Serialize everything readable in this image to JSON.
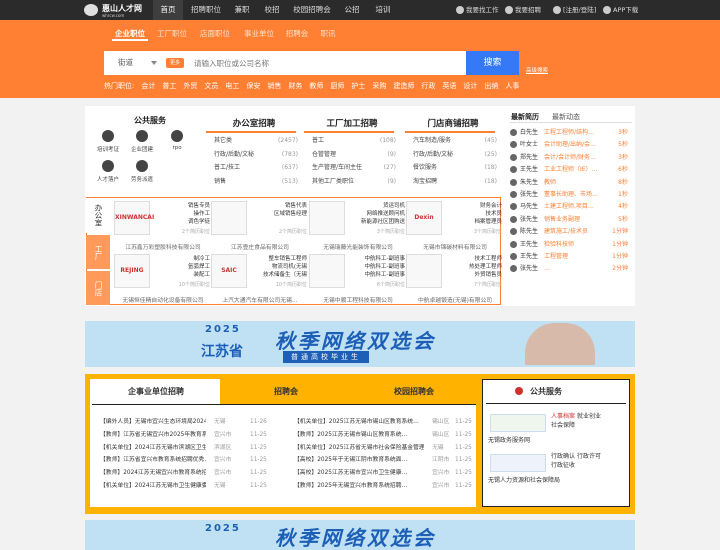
{
  "topbar": {
    "logo_name": "惠山人才网",
    "logo_sub": "whrcw.com",
    "nav": [
      "首页",
      "招聘职位",
      "兼职",
      "校招",
      "校园招聘会",
      "公招",
      "培训"
    ],
    "right": [
      "我要找工作",
      "我要招聘",
      "[注册/登陆]",
      "APP下载"
    ]
  },
  "search_tabs": [
    "企业职位",
    "工厂职位",
    "店面职位",
    "事业单位",
    "招聘会",
    "职讯"
  ],
  "search": {
    "city": "街道",
    "tag": "更多",
    "placeholder": "请输入职位或公司名称",
    "button": "搜索",
    "advanced": "高级搜索"
  },
  "hot": {
    "label": "热门职位:",
    "items": [
      "会计",
      "普工",
      "外贸",
      "文员",
      "电工",
      "保安",
      "销售",
      "财务",
      "教师",
      "厨师",
      "护士",
      "采购",
      "建造师",
      "行政",
      "英语",
      "设计",
      "出纳",
      "人事"
    ]
  },
  "public_services": {
    "title": "公共服务",
    "items": [
      "培训考证",
      "企业团建",
      "rpo",
      "人才落户",
      "劳务派遣"
    ]
  },
  "columns": [
    {
      "title": "办公室招聘",
      "rows": [
        {
          "n": "其它类",
          "c": "(2457)"
        },
        {
          "n": "行政/后勤/文秘",
          "c": "(783)"
        },
        {
          "n": "普工/技工",
          "c": "(637)"
        },
        {
          "n": "销售",
          "c": "(513)"
        }
      ]
    },
    {
      "title": "工厂加工招聘",
      "rows": [
        {
          "n": "普工",
          "c": "(108)"
        },
        {
          "n": "仓管管理",
          "c": "(9)"
        },
        {
          "n": "生产管理/车间主任",
          "c": "(27)"
        },
        {
          "n": "其他工厂类职位",
          "c": "(9)"
        }
      ]
    },
    {
      "title": "门店商铺招聘",
      "rows": [
        {
          "n": "汽车制造/服务",
          "c": "(45)"
        },
        {
          "n": "行政/后勤/文秘",
          "c": "(25)"
        },
        {
          "n": "餐饮服务",
          "c": "(18)"
        },
        {
          "n": "淘宝招聘",
          "c": "(18)"
        }
      ]
    }
  ],
  "news": {
    "tabs": [
      "最新简历",
      "最新动态"
    ],
    "rows": [
      {
        "n": "白先生",
        "p": "工程工程师/结构…",
        "t": "3秒"
      },
      {
        "n": "叶女士",
        "p": "会计助理/出纳/会…",
        "t": "5秒"
      },
      {
        "n": "郑先生",
        "p": "会计/会计师/财务…",
        "t": "3秒"
      },
      {
        "n": "王先生",
        "p": "工业工程师（IE）…",
        "t": "6秒"
      },
      {
        "n": "朱先生",
        "p": "教师",
        "t": "8秒"
      },
      {
        "n": "张先生",
        "p": "董事长助理、市场…",
        "t": "1秒"
      },
      {
        "n": "马先生",
        "p": "土建工程师,项目…",
        "t": "4秒"
      },
      {
        "n": "张先生",
        "p": "销售业务副理",
        "t": "5秒"
      },
      {
        "n": "陈先生",
        "p": "建筑施工/技术员",
        "t": "1分钟"
      },
      {
        "n": "王先生",
        "p": "检验科技师",
        "t": "1分钟"
      },
      {
        "n": "王先生",
        "p": "工程管理",
        "t": "1分钟"
      },
      {
        "n": "张先生",
        "p": "…",
        "t": "2分钟"
      }
    ]
  },
  "company_tabs": [
    "办公室",
    "工厂",
    "门店"
  ],
  "companies": [
    {
      "logo": "XINWANCAI",
      "pos": "销售专员\n操作工\n调色学徒",
      "note": "2个简历职位",
      "name": "江苏鑫万彩塑胶科技有限公司"
    },
    {
      "logo": "",
      "pos": "销售代表\n区域销售经理",
      "note": "2个简历职位",
      "name": "江苏壹庄食品有限公司"
    },
    {
      "logo": "",
      "pos": "货运司机\n网络推送顾问机\n新能源社区团购送",
      "note": "3个简历职位",
      "name": "无锡瑞藤光能装饰有限公司"
    },
    {
      "logo": "Dexin",
      "pos": "财务会计\n技术员\n档案管理员",
      "note": "3个简历职位",
      "name": "无锡市锦碳材料有限公司"
    },
    {
      "logo": "REJING",
      "pos": "制冷工\n氩弧焊工\n装配工",
      "note": "10个简历职位",
      "name": "无锡恒佳精自动化设备有限公司"
    },
    {
      "logo": "SAIC",
      "pos": "整车销售工程师\n物流司机(无锡\n技术储备生（无锡",
      "note": "10个简历职位",
      "name": "上汽大通汽车有限公司无锡…"
    },
    {
      "logo": "",
      "pos": "中航科工-副班事\n中航科工-副班事\n中航科工-副班事",
      "note": "6个简历职位",
      "name": "无锡中顺工程科技有限公司"
    },
    {
      "logo": "",
      "pos": "技术工程师\n热处理工程师\n外贸销售员",
      "note": "7个简历职位",
      "name": "中航卓越锻造(无锡)有限公司"
    }
  ],
  "banner": {
    "year": "2025",
    "province": "江苏省",
    "title": "秋季网络双选会",
    "sub": "普通高校毕业生"
  },
  "lower_tabs": [
    "企事业单位招聘",
    "招聘会",
    "校园招聘会"
  ],
  "lower_left": [
    {
      "t": "【编外人员】无锡市宜兴生态环境局2024年公…",
      "r": "无锡",
      "d": "11-26"
    },
    {
      "t": "【教师】江苏省无锡宜兴市2025年教育系…",
      "r": "宜兴市",
      "d": "11-25"
    },
    {
      "t": "【机关单位】2024江苏无锡市滨湖区卫生健康…",
      "r": "滨湖区",
      "d": "11-25"
    },
    {
      "t": "【教师】江苏省宜兴市教育系统招聘优秀…",
      "r": "宜兴市",
      "d": "11-25"
    },
    {
      "t": "【教师】2024江苏无锡宜兴市教育系统招聘…",
      "r": "宜兴市",
      "d": "11-25"
    },
    {
      "t": "【机关单位】2024江苏无锡市卫生健康委直属…",
      "r": "无锡",
      "d": "11-25"
    }
  ],
  "lower_mid": [
    {
      "t": "【机关单位】2025江苏无锡市锡山区教育系统…",
      "r": "锡山区",
      "d": "11-25"
    },
    {
      "t": "【教师】2025江苏无锡市锡山区教育系统…",
      "r": "锡山区",
      "d": "11-25"
    },
    {
      "t": "【机关单位】2025江苏省无锡市社会保险基金管理…",
      "r": "无锡",
      "d": "11-25"
    },
    {
      "t": "【高校】2025年于无锡江阴市教育系统面…",
      "r": "江阴市",
      "d": "11-25"
    },
    {
      "t": "【高校】2025江苏无锡市宜兴市卫生健康…",
      "r": "宜兴市",
      "d": "11-25"
    },
    {
      "t": "【教师】2025年无锡宜兴市教育系统招聘…",
      "r": "宜兴市",
      "d": "11-25"
    }
  ],
  "pub_service": {
    "title": "公共服务",
    "item1_lines": [
      "人事档案",
      "就业创业",
      "社会保障"
    ],
    "item1_name": "无锡政务服务网",
    "item2_lines": [
      "行政确认",
      "行政许可",
      "行政征收"
    ],
    "item2_name": "无锡人力资源和社会保障局"
  },
  "colors": {
    "accent": "#ff7f33",
    "topbar": "#2b2b2b",
    "button": "#3679f6",
    "yellow": "#ffb300"
  }
}
